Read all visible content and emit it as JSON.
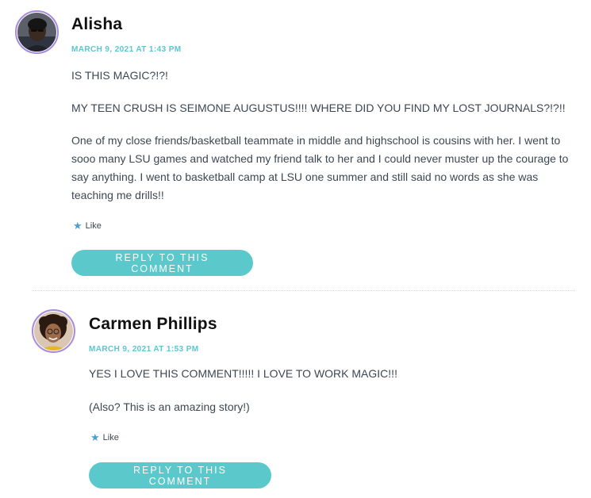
{
  "comments": [
    {
      "author": "Alisha",
      "date": "MARCH 9, 2021 AT 1:43 PM",
      "paragraphs": [
        "IS THIS MAGIC?!?!",
        "MY TEEN CRUSH IS SEIMONE AUGUSTUS!!!! WHERE DID YOU FIND MY LOST JOURNALS?!?!!",
        "One of my close friends/basketball teammate in middle and highschool is cousins with her. I went to sooo many LSU games and watched my friend talk to her and I could never muster up the courage to say anything. I went to basketball camp at LSU one summer and still said no words as she was teaching me drills!!"
      ],
      "like_label": "Like",
      "reply_label": "REPLY TO THIS COMMENT"
    },
    {
      "author": "Carmen Phillips",
      "date": "MARCH 9, 2021 AT 1:53 PM",
      "paragraphs": [
        "YES I LOVE THIS COMMENT!!!!! I LOVE TO WORK MAGIC!!!",
        "(Also? This is an amazing story!)"
      ],
      "like_label": "Like",
      "reply_label": "REPLY TO THIS COMMENT"
    }
  ],
  "colors": {
    "accent": "#5bc9cc",
    "date": "#5bc6cf",
    "avatar_ring": "#a78bde",
    "like_star": "#4a9fd6"
  },
  "icons": {
    "like": "star-icon"
  }
}
